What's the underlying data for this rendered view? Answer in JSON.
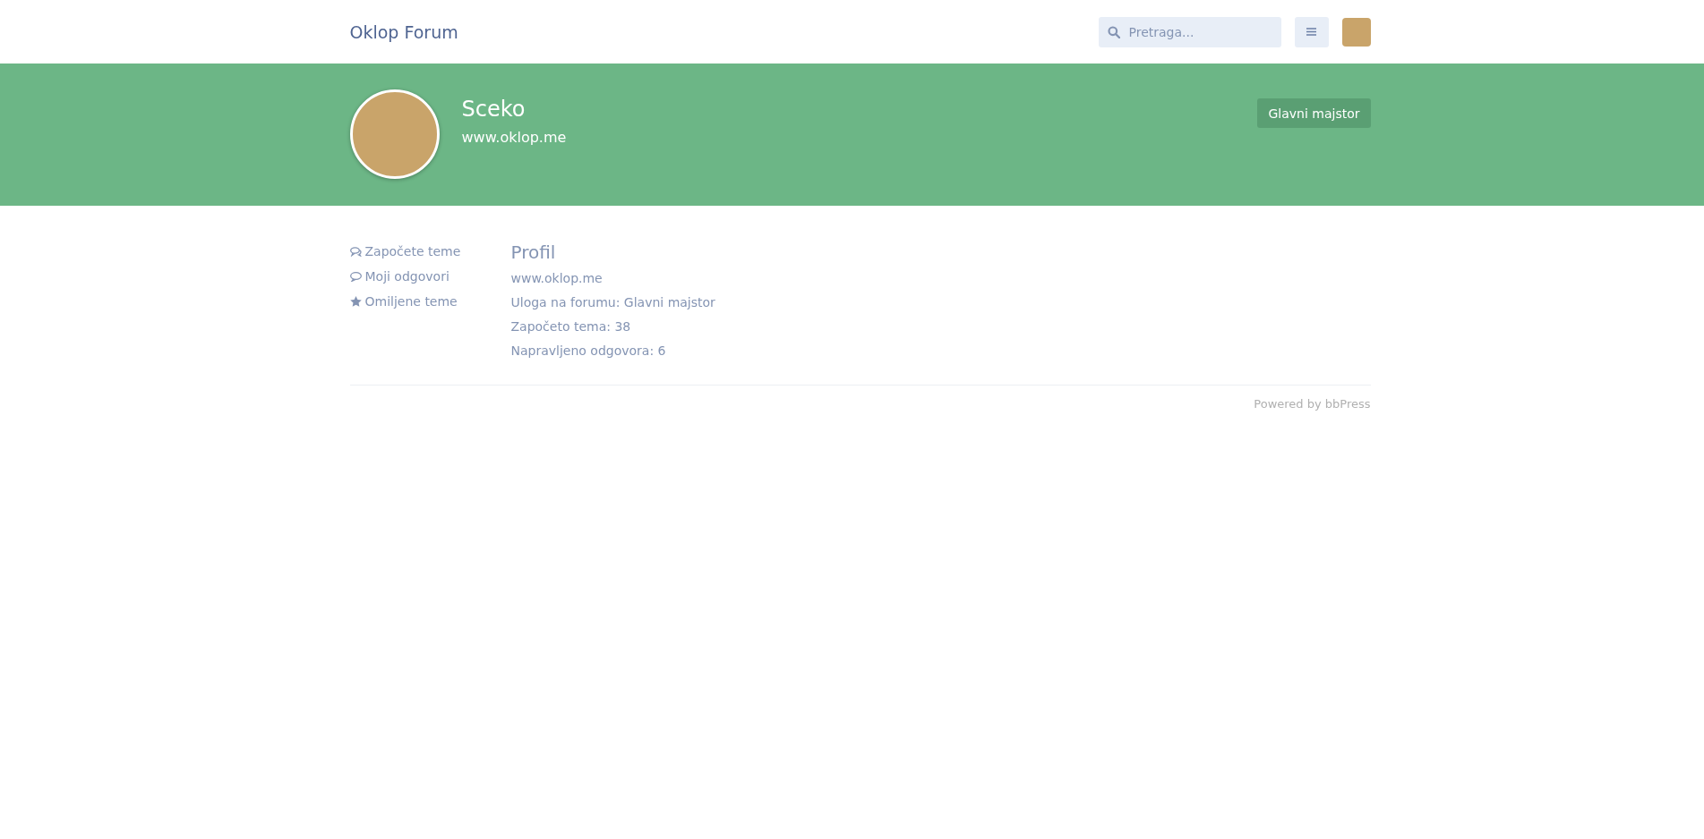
{
  "header": {
    "brand": "Oklop Forum",
    "search": {
      "placeholder": "Pretraga..."
    }
  },
  "profile": {
    "name": "Sceko",
    "website": "www.oklop.me",
    "role_badge": "Glavni majstor"
  },
  "sidebar": {
    "items": [
      {
        "kind": "topics",
        "label": "Započete teme"
      },
      {
        "kind": "replies",
        "label": "Moji odgovori"
      },
      {
        "kind": "favorites",
        "label": "Omiljene teme"
      }
    ]
  },
  "content": {
    "title": "Profil",
    "lines": [
      "www.oklop.me",
      "Uloga na forumu: Glavni majstor",
      "Započeto tema: 38",
      "Napravljeno odgovora: 6"
    ]
  },
  "footer": {
    "text": "Powered by bbPress"
  }
}
